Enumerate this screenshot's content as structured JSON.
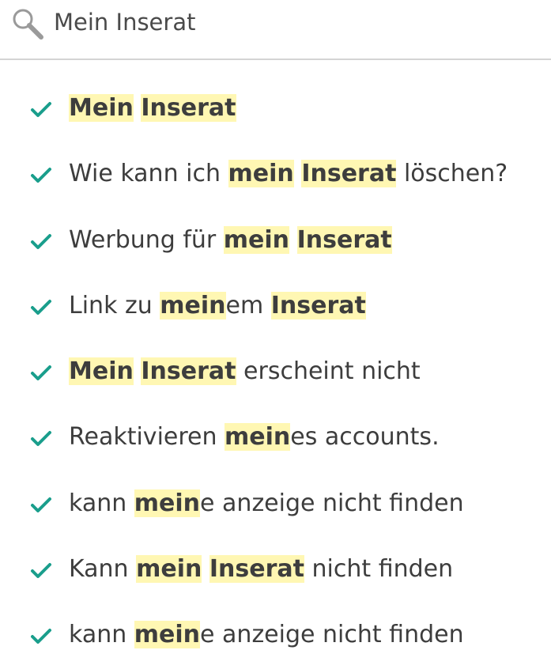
{
  "search": {
    "value": "Mein Inserat",
    "icon": "search-icon"
  },
  "colors": {
    "highlight": "#fff7b3",
    "check": "#1a9e8c",
    "text": "#3d3d3d",
    "divider": "#d4d4d4"
  },
  "results": [
    {
      "segments": [
        {
          "t": "Mein",
          "h": true
        },
        {
          "t": " ",
          "h": false
        },
        {
          "t": "Inserat",
          "h": true
        }
      ]
    },
    {
      "segments": [
        {
          "t": "Wie kann ich ",
          "h": false
        },
        {
          "t": "mein",
          "h": true
        },
        {
          "t": " ",
          "h": false
        },
        {
          "t": "Inserat",
          "h": true
        },
        {
          "t": " löschen?",
          "h": false
        }
      ]
    },
    {
      "segments": [
        {
          "t": "Werbung für ",
          "h": false
        },
        {
          "t": "mein",
          "h": true
        },
        {
          "t": " ",
          "h": false
        },
        {
          "t": "Inserat",
          "h": true
        }
      ]
    },
    {
      "segments": [
        {
          "t": "Link zu ",
          "h": false
        },
        {
          "t": "mein",
          "h": true
        },
        {
          "t": "em ",
          "h": false
        },
        {
          "t": "Inserat",
          "h": true
        }
      ]
    },
    {
      "segments": [
        {
          "t": "Mein",
          "h": true
        },
        {
          "t": " ",
          "h": false
        },
        {
          "t": "Inserat",
          "h": true
        },
        {
          "t": " erscheint nicht",
          "h": false
        }
      ]
    },
    {
      "segments": [
        {
          "t": "Reaktivieren ",
          "h": false
        },
        {
          "t": "mein",
          "h": true
        },
        {
          "t": "es accounts.",
          "h": false
        }
      ]
    },
    {
      "segments": [
        {
          "t": "kann ",
          "h": false
        },
        {
          "t": "mein",
          "h": true
        },
        {
          "t": "e anzeige nicht finden",
          "h": false
        }
      ]
    },
    {
      "segments": [
        {
          "t": "Kann ",
          "h": false
        },
        {
          "t": "mein",
          "h": true
        },
        {
          "t": " ",
          "h": false
        },
        {
          "t": "Inserat",
          "h": true
        },
        {
          "t": " nicht finden",
          "h": false
        }
      ]
    },
    {
      "segments": [
        {
          "t": "kann ",
          "h": false
        },
        {
          "t": "mein",
          "h": true
        },
        {
          "t": "e anzeige nicht finden",
          "h": false
        }
      ]
    }
  ]
}
